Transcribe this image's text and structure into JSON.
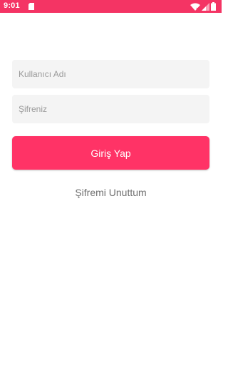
{
  "status_bar": {
    "time": "9:01",
    "background": "#f43464",
    "icons": [
      "sd-card-icon",
      "wifi-icon",
      "signal-icon",
      "battery-icon"
    ]
  },
  "login_form": {
    "username": {
      "placeholder": "Kullanıcı Adı",
      "value": ""
    },
    "password": {
      "placeholder": "Şifreniz",
      "value": ""
    },
    "submit_label": "Giriş Yap",
    "forgot_password_label": "Şifremi Unuttum",
    "accent_color": "#ff3366",
    "field_background": "#f4f4f4"
  }
}
